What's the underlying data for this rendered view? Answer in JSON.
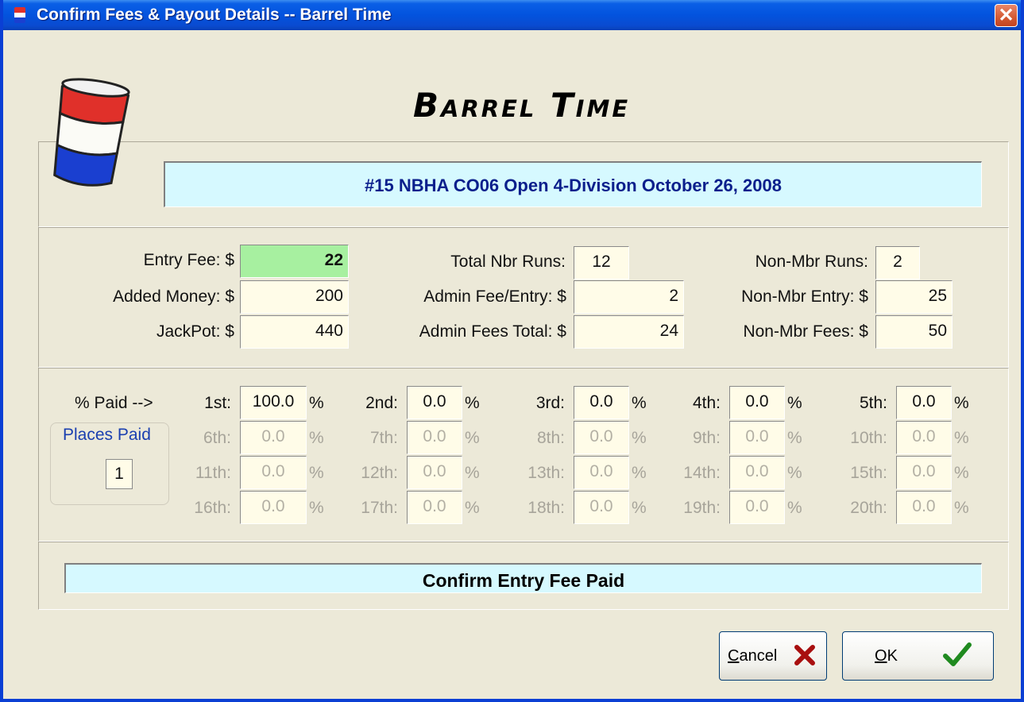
{
  "window": {
    "title": "Confirm Fees & Payout Details -- Barrel Time",
    "close_symbol": "✕",
    "icon": "barrel-flag-icon"
  },
  "header": {
    "app_name": "Barrel Time",
    "event": "#15 NBHA CO06  Open 4-Division  October 26, 2008",
    "logo_icon": "barrel-icon"
  },
  "fees": {
    "entry_fee_label": "Entry Fee: $",
    "entry_fee": "22",
    "added_money_label": "Added Money: $",
    "added_money": "200",
    "jackpot_label": "JackPot: $",
    "jackpot": "440",
    "total_runs_label": "Total Nbr Runs:",
    "total_runs": "12",
    "admin_fee_label": "Admin Fee/Entry: $",
    "admin_fee": "2",
    "admin_total_label": "Admin Fees Total: $",
    "admin_total": "24",
    "nonmbr_runs_label": "Non-Mbr Runs:",
    "nonmbr_runs": "2",
    "nonmbr_entry_label": "Non-Mbr Entry: $",
    "nonmbr_entry": "25",
    "nonmbr_fees_label": "Non-Mbr Fees: $",
    "nonmbr_fees": "50"
  },
  "payout": {
    "pct_paid_label": "% Paid -->",
    "places_paid_label": "Places Paid",
    "places_paid": "1",
    "percent_sign": "%",
    "places": [
      {
        "label": "1st:",
        "value": "100.0"
      },
      {
        "label": "2nd:",
        "value": "0.0"
      },
      {
        "label": "3rd:",
        "value": "0.0"
      },
      {
        "label": "4th:",
        "value": "0.0"
      },
      {
        "label": "5th:",
        "value": "0.0"
      },
      {
        "label": "6th:",
        "value": "0.0"
      },
      {
        "label": "7th:",
        "value": "0.0"
      },
      {
        "label": "8th:",
        "value": "0.0"
      },
      {
        "label": "9th:",
        "value": "0.0"
      },
      {
        "label": "10th:",
        "value": "0.0"
      },
      {
        "label": "11th:",
        "value": "0.0"
      },
      {
        "label": "12th:",
        "value": "0.0"
      },
      {
        "label": "13th:",
        "value": "0.0"
      },
      {
        "label": "14th:",
        "value": "0.0"
      },
      {
        "label": "15th:",
        "value": "0.0"
      },
      {
        "label": "16th:",
        "value": "0.0"
      },
      {
        "label": "17th:",
        "value": "0.0"
      },
      {
        "label": "18th:",
        "value": "0.0"
      },
      {
        "label": "19th:",
        "value": "0.0"
      },
      {
        "label": "20th:",
        "value": "0.0"
      }
    ]
  },
  "confirm_bar": "Confirm Entry Fee Paid",
  "buttons": {
    "cancel": "Cancel",
    "cancel_icon": "red-x-icon",
    "ok": "OK",
    "ok_icon": "green-check-icon"
  },
  "colors": {
    "title_bar": "#0353de",
    "event_text": "#0b1f8c",
    "cyan_bar": "#d6f9ff",
    "entry_fee_highlight": "#a7f0a0",
    "field_bg": "#fffce8"
  }
}
